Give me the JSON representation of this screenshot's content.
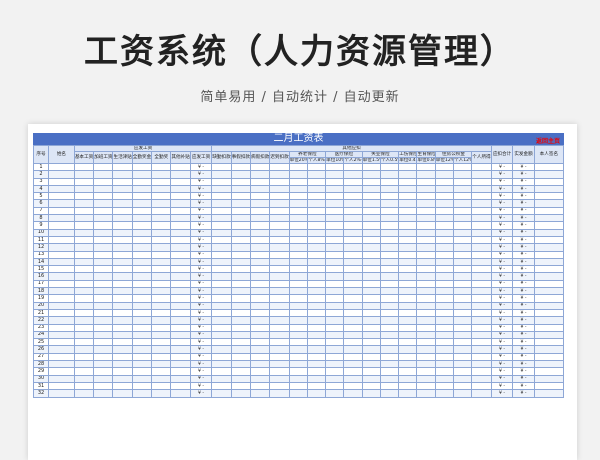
{
  "hero": {
    "title": "工资系统（人力资源管理）",
    "subtitle": "简单易用 / 自动统计 / 自动更新"
  },
  "sheet": {
    "title": "二月工资表",
    "return_link": "返回主页",
    "groups": {
      "payable": "应发工资",
      "other_deductions": "其他应扣",
      "pension": "养老保险",
      "medical": "医疗保险",
      "unemployment": "失业保险",
      "injury": "工伤保险",
      "maternity": "生育保险",
      "housing_fund": "住房公积金"
    },
    "headers": {
      "seq": "序号",
      "name": "姓名",
      "base": "基本工资",
      "overtime": "加班工资",
      "living": "生活津贴",
      "attendance": "全勤奖金",
      "bonus": "全勤奖",
      "other_allow": "其他补贴",
      "payable_total": "应发工资",
      "leave": "缺勤扣款",
      "personal_leave": "事假扣款",
      "sick_leave": "病假扣款",
      "late": "迟到扣款",
      "pension_unit": "单位20%",
      "pension_person": "个人8%",
      "medical_unit": "单位10%",
      "medical_person": "个人2%+3",
      "unemp_unit": "单位1.5%",
      "unemp_person": "个人0.5%",
      "injury_unit": "单位0.4%",
      "maternity_unit": "单位0.8%",
      "fund_unit": "单位12%",
      "fund_person": "个人12%",
      "income_tax": "个人所得税",
      "deduct_total": "应扣合计",
      "net_pay": "实发金额",
      "signature": "本人签名"
    },
    "amount_placeholder": "¥ -",
    "row_count": 32
  }
}
